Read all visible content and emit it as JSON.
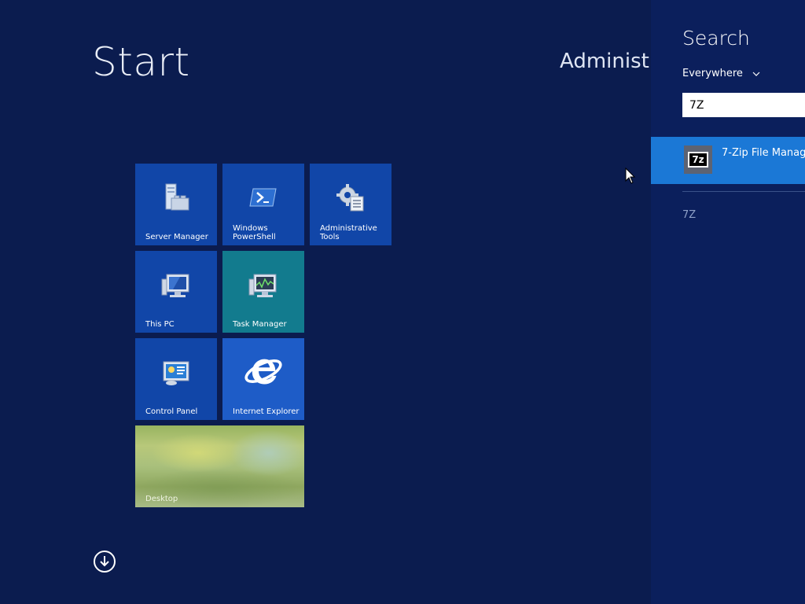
{
  "start": {
    "title": "Start",
    "user_name": "Administra"
  },
  "tiles": [
    {
      "label": "Server Manager",
      "icon": "server-manager-icon"
    },
    {
      "label": "Windows PowerShell",
      "icon": "powershell-icon"
    },
    {
      "label": "Administrative Tools",
      "icon": "admin-tools-icon"
    },
    {
      "label": "This PC",
      "icon": "computer-icon"
    },
    {
      "label": "Task Manager",
      "icon": "task-manager-icon"
    },
    {
      "label": "Control Panel",
      "icon": "control-panel-icon"
    },
    {
      "label": "Internet Explorer",
      "icon": "internet-explorer-icon"
    },
    {
      "label": "Desktop",
      "icon": "desktop-wallpaper"
    }
  ],
  "apps_button_icon": "down-arrow-circle-icon",
  "search": {
    "title": "Search",
    "scope": "Everywhere",
    "query": "7Z",
    "results": [
      {
        "label": "7-Zip File Manag",
        "icon": "7zip-icon",
        "icon_text": "7z"
      }
    ],
    "suggestions": [
      "7Z"
    ]
  },
  "colors": {
    "background": "#0b1c4f",
    "tile_blue": "#1146a8",
    "tile_teal": "#127b8e",
    "search_pane": "#0b1f5c",
    "selected_result": "#1b78d6"
  }
}
